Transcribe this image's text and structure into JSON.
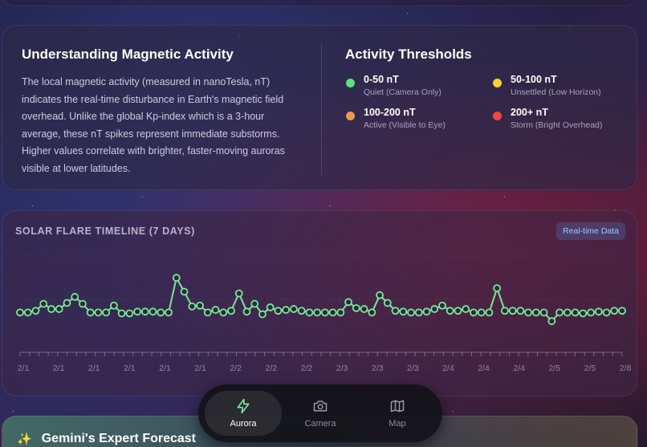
{
  "info": {
    "title": "Understanding Magnetic Activity",
    "body": "The local magnetic activity (measured in nanoTesla, nT) indicates the real-time disturbance in Earth's magnetic field overhead. Unlike the global Kp-index which is a 3-hour average, these nT spikes represent immediate substorms. Higher values correlate with brighter, faster-moving auroras visible at lower latitudes."
  },
  "thresholds": {
    "title": "Activity Thresholds",
    "items": [
      {
        "range": "0-50 nT",
        "desc": "Quiet (Camera Only)",
        "color": "#5ee07a"
      },
      {
        "range": "50-100 nT",
        "desc": "Unsettled (Low Horizon)",
        "color": "#f2d13a"
      },
      {
        "range": "100-200 nT",
        "desc": "Active (Visible to Eye)",
        "color": "#f09a42"
      },
      {
        "range": "200+ nT",
        "desc": "Storm (Bright Overhead)",
        "color": "#e84a4a"
      }
    ]
  },
  "chart": {
    "title": "SOLAR FLARE TIMELINE (7 DAYS)",
    "badge": "Real-time Data"
  },
  "chart_data": {
    "type": "line",
    "title": "SOLAR FLARE TIMELINE (7 DAYS)",
    "series_color": "#7be79a",
    "grid": true,
    "ylim": [
      0,
      100
    ],
    "x_ticks": [
      "2/1",
      "2/1",
      "2/1",
      "2/1",
      "2/1",
      "2/1",
      "2/2",
      "2/2",
      "2/2",
      "2/3",
      "2/3",
      "2/3",
      "2/4",
      "2/4",
      "2/4",
      "2/5",
      "2/5",
      "2/8"
    ],
    "values": [
      20,
      20,
      22,
      30,
      24,
      24,
      31,
      38,
      30,
      20,
      20,
      20,
      28,
      19,
      19,
      21,
      21,
      21,
      20,
      20,
      60,
      44,
      27,
      28,
      20,
      23,
      20,
      22,
      42,
      21,
      30,
      18,
      26,
      22,
      23,
      24,
      22,
      20,
      20,
      20,
      20,
      20,
      32,
      25,
      24,
      20,
      40,
      31,
      22,
      21,
      20,
      20,
      21,
      24,
      28,
      22,
      22,
      24,
      20,
      20,
      20,
      48,
      22,
      22,
      22,
      20,
      20,
      20,
      10,
      20,
      20,
      20,
      19,
      20,
      21,
      20,
      22,
      22
    ]
  },
  "gemini": {
    "icon": "sparkle-icon",
    "title": "Gemini's Expert Forecast"
  },
  "nav": {
    "items": [
      {
        "label": "Aurora",
        "icon": "lightning-icon",
        "active": true
      },
      {
        "label": "Camera",
        "icon": "camera-icon",
        "active": false
      },
      {
        "label": "Map",
        "icon": "map-icon",
        "active": false
      }
    ]
  }
}
